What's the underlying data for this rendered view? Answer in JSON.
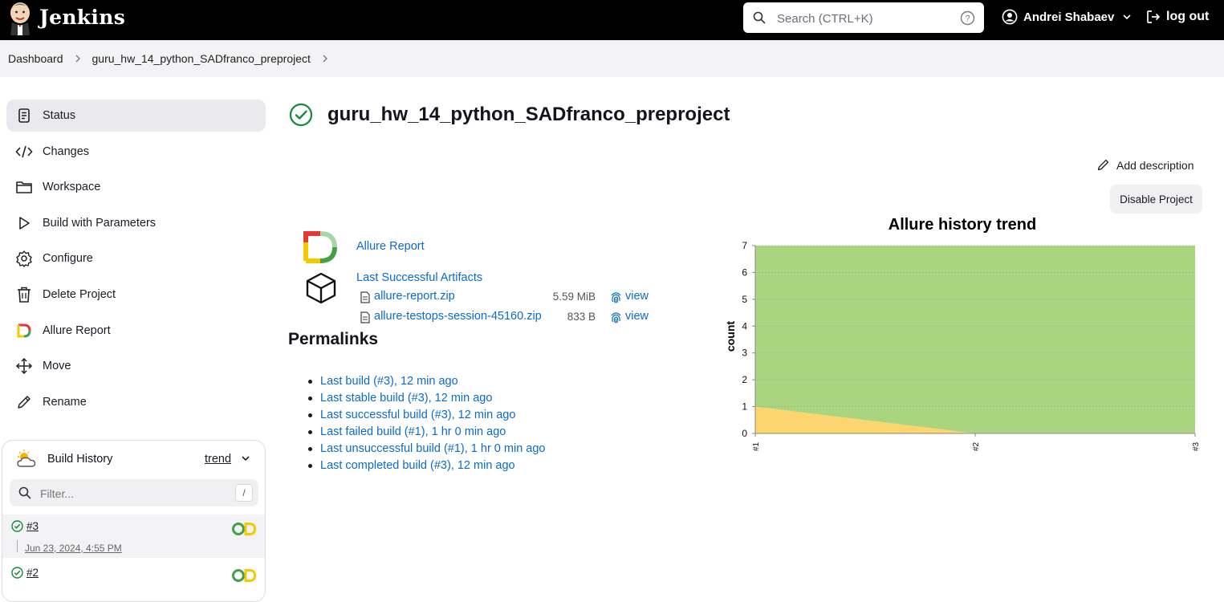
{
  "header": {
    "brand": "Jenkins",
    "search_placeholder": "Search (CTRL+K)",
    "user_name": "Andrei Shabaev",
    "logout_label": "log out"
  },
  "breadcrumb": [
    "Dashboard",
    "guru_hw_14_python_SADfranco_preproject"
  ],
  "sidebar": {
    "items": [
      {
        "label": "Status",
        "icon": "document-icon"
      },
      {
        "label": "Changes",
        "icon": "code-icon"
      },
      {
        "label": "Workspace",
        "icon": "folder-icon"
      },
      {
        "label": "Build with Parameters",
        "icon": "play-icon"
      },
      {
        "label": "Configure",
        "icon": "gear-icon"
      },
      {
        "label": "Delete Project",
        "icon": "trash-icon"
      },
      {
        "label": "Allure Report",
        "icon": "allure-icon"
      },
      {
        "label": "Move",
        "icon": "move-icon"
      },
      {
        "label": "Rename",
        "icon": "pencil-icon"
      }
    ]
  },
  "build_history": {
    "title": "Build History",
    "trend_label": "trend",
    "filter_placeholder": "Filter...",
    "filter_shortcut": "/",
    "runs": [
      {
        "number": "#3",
        "date": "Jun 23, 2024, 4:55 PM",
        "status": "success"
      },
      {
        "number": "#2",
        "status": "success"
      }
    ]
  },
  "main": {
    "project_title": "guru_hw_14_python_SADfranco_preproject",
    "add_description_label": "Add description",
    "disable_label": "Disable Project",
    "allure_report_label": "Allure Report",
    "artifacts_label": "Last Successful Artifacts",
    "artifacts": [
      {
        "name": "allure-report.zip",
        "size": "5.59 MiB",
        "view": "view"
      },
      {
        "name": "allure-testops-session-45160.zip",
        "size": "833 B",
        "view": "view"
      }
    ],
    "permalinks_title": "Permalinks",
    "permalinks": [
      "Last build (#3), 12 min ago",
      "Last stable build (#3), 12 min ago",
      "Last successful build (#3), 12 min ago",
      "Last failed build (#1), 1 hr 0 min ago",
      "Last unsuccessful build (#1), 1 hr 0 min ago",
      "Last completed build (#3), 12 min ago"
    ]
  },
  "colors": {
    "link": "#0b6bcb",
    "success": "#138a36",
    "chart_passed": "#aad47f",
    "chart_broken": "#fdd56e"
  },
  "chart_data": {
    "type": "area",
    "title": "Allure history trend",
    "xlabel": "",
    "ylabel": "count",
    "categories": [
      "#1",
      "#2",
      "#3"
    ],
    "ylim": [
      0,
      7
    ],
    "yticks": [
      0,
      1,
      2,
      3,
      4,
      5,
      6,
      7
    ],
    "grid": true,
    "series": [
      {
        "values": [
          1,
          0,
          0
        ],
        "color": "#fdd56e"
      },
      {
        "values": [
          6,
          7,
          7
        ],
        "color": "#aad47f"
      }
    ]
  }
}
